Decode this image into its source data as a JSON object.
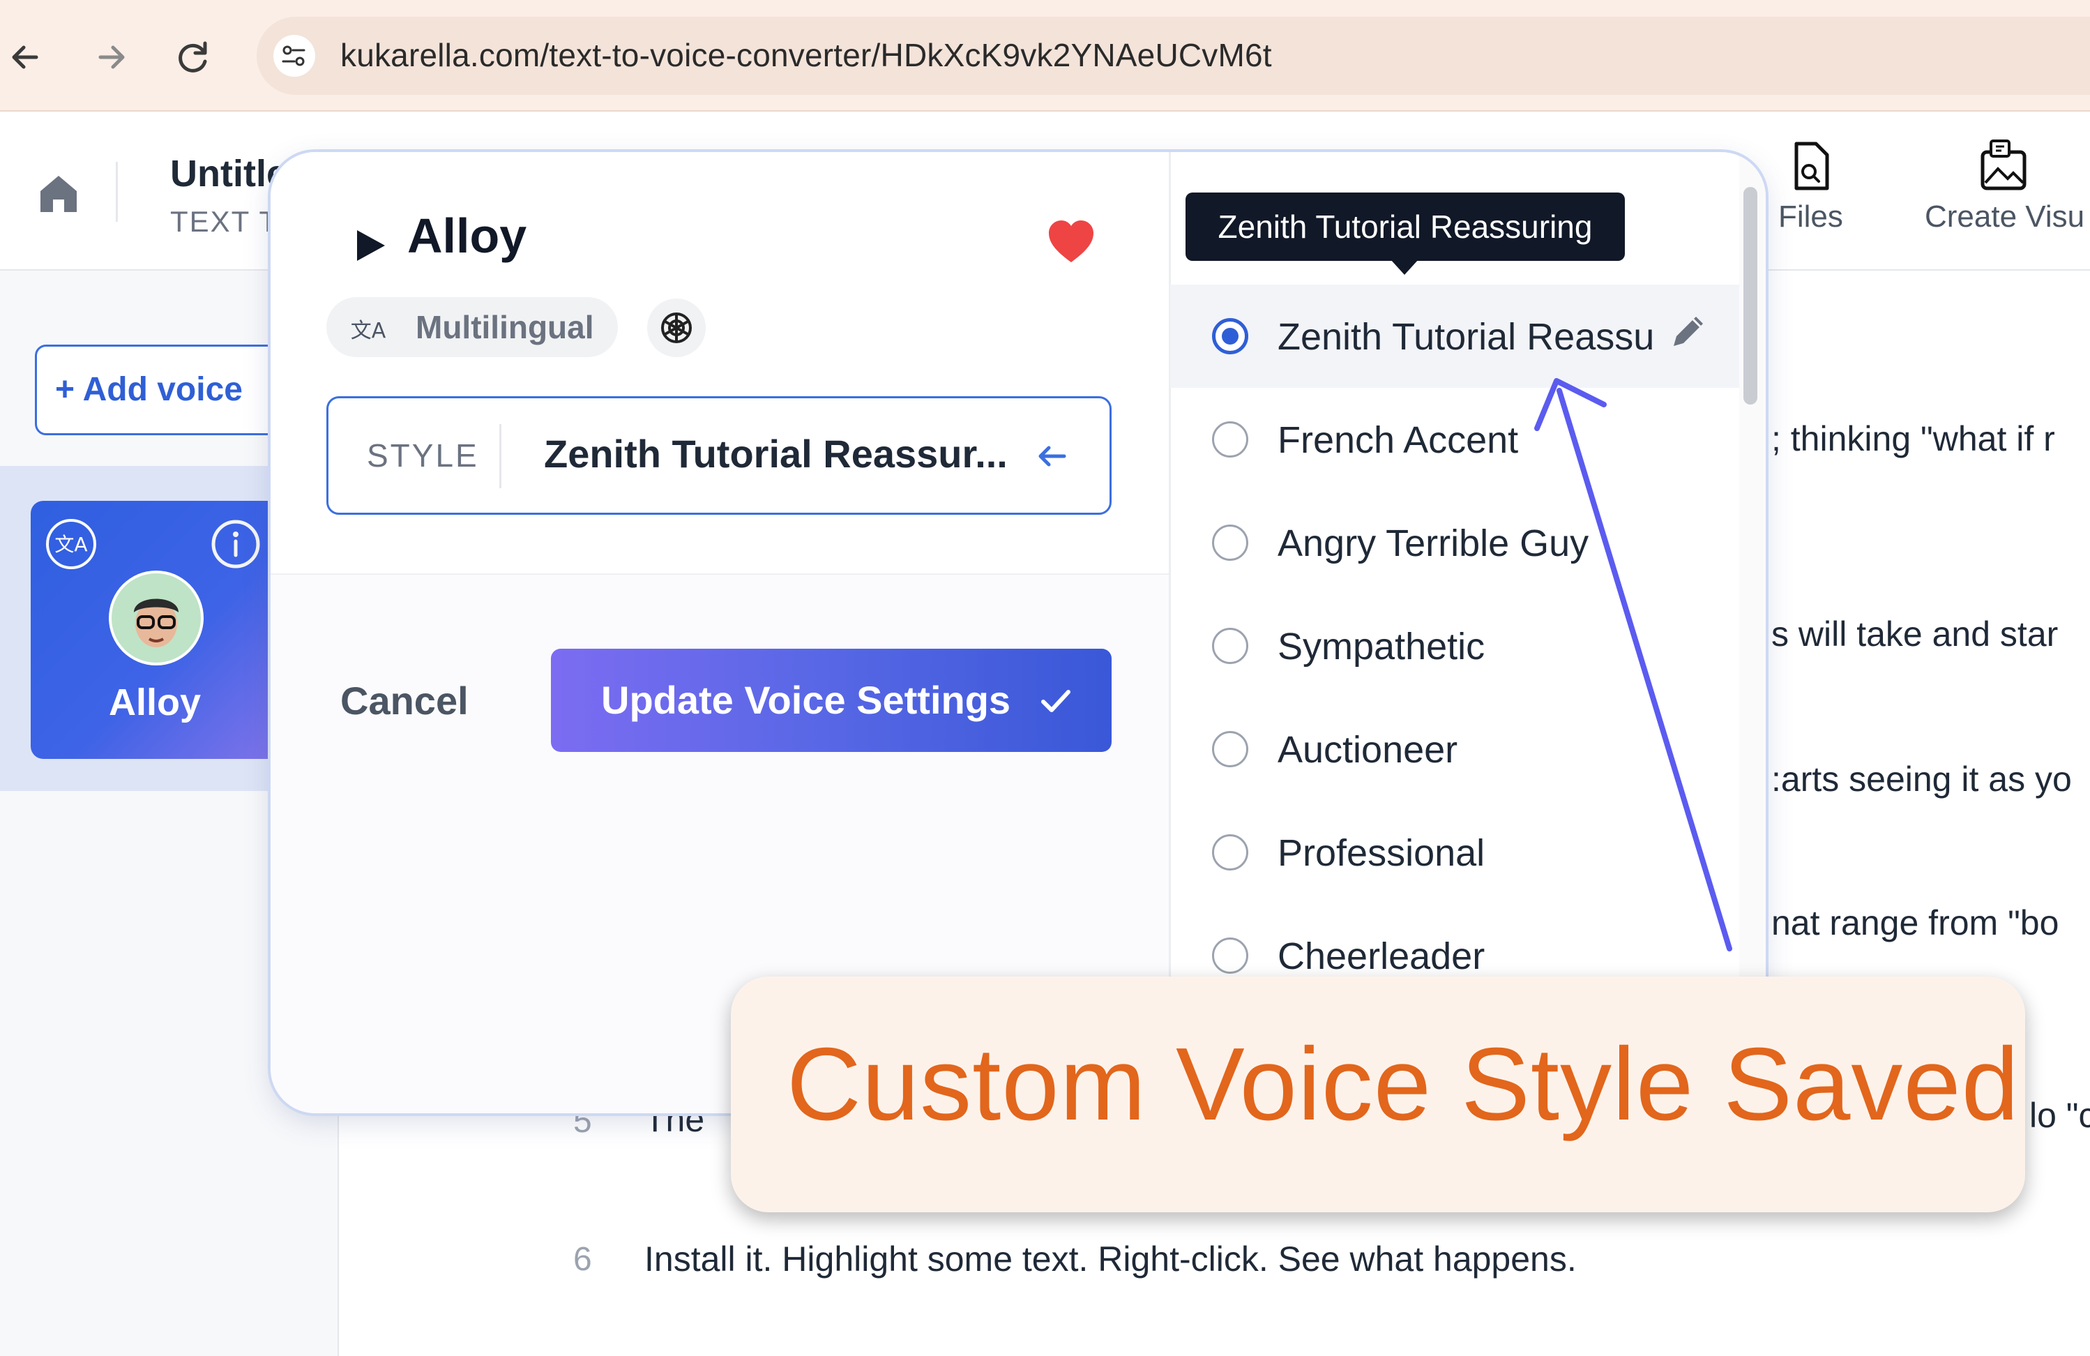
{
  "browser": {
    "url": "kukarella.com/text-to-voice-converter/HDkXcK9vk2YNAeUCvM6t",
    "back_icon": "arrow-left-icon",
    "forward_icon": "arrow-right-icon",
    "reload_icon": "reload-icon",
    "site_settings_icon": "tune-icon"
  },
  "header": {
    "title": "Untitle",
    "subtitle": "TEXT T",
    "toolbar": [
      {
        "label": "Files",
        "icon": "file-search-icon"
      },
      {
        "label": "Create Visu",
        "icon": "image-plus-icon"
      }
    ]
  },
  "sidebar": {
    "add_voice_label": "+ Add voice",
    "voice_card": {
      "name": "Alloy",
      "lang_icon": "translate-icon",
      "info_icon": "info-icon"
    }
  },
  "editor": {
    "line_fragments": [
      "; thinking \"what if r",
      "s will take and star",
      ":arts seeing it as yo",
      "nat range from \"bo",
      "lo \"c"
    ],
    "lines": [
      {
        "number": "5",
        "text": "The"
      },
      {
        "number": "6",
        "text": "Install it. Highlight some text. Right-click. See what happens."
      }
    ]
  },
  "popup": {
    "voice_name": "Alloy",
    "favorite_color": "#ef4444",
    "multilingual_label": "Multilingual",
    "style_label": "STYLE",
    "style_value": "Zenith Tutorial Reassur...",
    "cancel_label": "Cancel",
    "update_label": "Update Voice Settings",
    "accent_color": "#3b6fe0",
    "styles": [
      {
        "name": "Zenith Tutorial Reassu",
        "selected": true
      },
      {
        "name": "French Accent",
        "selected": false
      },
      {
        "name": "Angry Terrible Guy",
        "selected": false
      },
      {
        "name": "Sympathetic",
        "selected": false
      },
      {
        "name": "Auctioneer",
        "selected": false
      },
      {
        "name": "Professional",
        "selected": false
      },
      {
        "name": "Cheerleader",
        "selected": false
      }
    ],
    "tooltip": "Zenith Tutorial Reassuring"
  },
  "callout": {
    "text": "Custom Voice Style Saved",
    "text_color": "#e2661c"
  }
}
